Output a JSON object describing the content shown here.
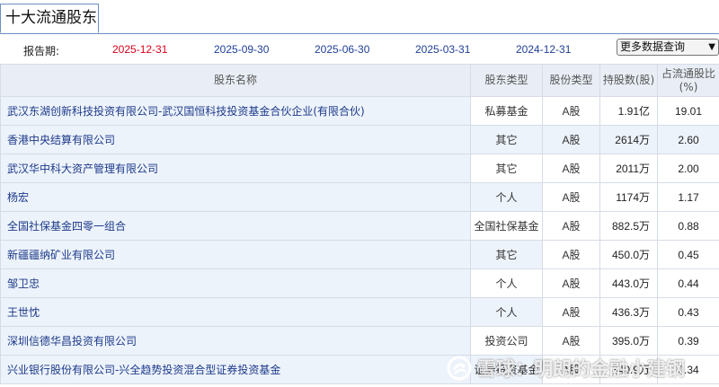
{
  "tab": {
    "title": "十大流通股东"
  },
  "periods": {
    "label": "报告期:",
    "items": [
      "2025-12-31",
      "2025-09-30",
      "2025-06-30",
      "2025-03-31",
      "2024-12-31"
    ],
    "active_index": 0
  },
  "more_select": {
    "value": "更多数据查询"
  },
  "table": {
    "headers": {
      "name": "股东名称",
      "holder_type": "股东类型",
      "share_type": "股份类型",
      "shares": "持股数(股)",
      "pct_line1": "占流通股比",
      "pct_line2": "(%)"
    },
    "rows": [
      {
        "name": "武汉东湖创新科技投资有限公司-武汉国恒科技投资基金合伙企业(有限合伙)",
        "holder_type": "私募基金",
        "share_type": "A股",
        "shares": "1.91亿",
        "pct": "19.01"
      },
      {
        "name": "香港中央结算有限公司",
        "holder_type": "其它",
        "share_type": "A股",
        "shares": "2614万",
        "pct": "2.60"
      },
      {
        "name": "武汉华中科大资产管理有限公司",
        "holder_type": "其它",
        "share_type": "A股",
        "shares": "2011万",
        "pct": "2.00"
      },
      {
        "name": "杨宏",
        "holder_type": "个人",
        "share_type": "A股",
        "shares": "1174万",
        "pct": "1.17"
      },
      {
        "name": "全国社保基金四零一组合",
        "holder_type": "全国社保基金",
        "share_type": "A股",
        "shares": "882.5万",
        "pct": "0.88"
      },
      {
        "name": "新疆疆纳矿业有限公司",
        "holder_type": "其它",
        "share_type": "A股",
        "shares": "450.0万",
        "pct": "0.45"
      },
      {
        "name": "邹卫忠",
        "holder_type": "个人",
        "share_type": "A股",
        "shares": "443.0万",
        "pct": "0.44"
      },
      {
        "name": "王世忱",
        "holder_type": "个人",
        "share_type": "A股",
        "shares": "436.3万",
        "pct": "0.43"
      },
      {
        "name": "深圳信德华昌投资有限公司",
        "holder_type": "投资公司",
        "share_type": "A股",
        "shares": "395.0万",
        "pct": "0.39"
      },
      {
        "name": "兴业银行股份有限公司-兴全趋势投资混合型证券投资基金",
        "holder_type": "证券投资基金",
        "share_type": "A股",
        "shares": "340.9万",
        "pct": "0.34"
      }
    ]
  },
  "watermark": {
    "text": "雪球：明朗的金融小建钢",
    "icon": "snowball-logo-icon"
  },
  "colors": {
    "active_period": "#d9001b",
    "period_link": "#1f3f99",
    "holder_link": "#1d3a8a",
    "header_bg": "#e9eef6",
    "row_bg": "#edf3fb"
  }
}
